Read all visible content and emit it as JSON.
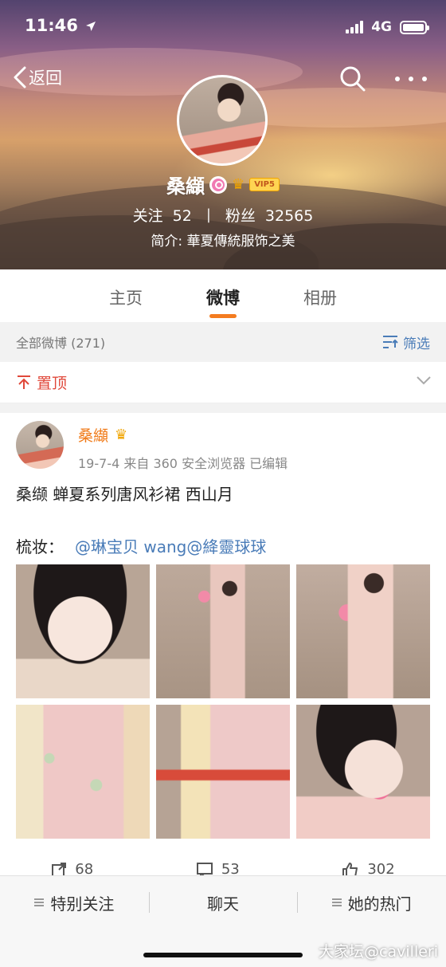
{
  "status_bar": {
    "time": "11:46",
    "network": "4G"
  },
  "nav": {
    "back_label": "返回"
  },
  "profile": {
    "name": "桑纈",
    "vip_label": "VIP5",
    "following_label": "关注",
    "following_count": "52",
    "followers_label": "粉丝",
    "followers_count": "32565",
    "bio": "简介: 華夏傳統服饰之美"
  },
  "tabs": [
    {
      "label": "主页",
      "active": false
    },
    {
      "label": "微博",
      "active": true
    },
    {
      "label": "相册",
      "active": false
    }
  ],
  "filter_bar": {
    "label": "全部微博 (271)",
    "filter_label": "筛选"
  },
  "pinned": {
    "label": "置顶"
  },
  "post": {
    "author": "桑纈",
    "meta": "19-7-4  来自 360 安全浏览器  已编辑",
    "text": "桑缬 蝉夏系列唐风衫裙 西山月",
    "makeup_label": "梳妆：",
    "mentions": "@琳宝贝 wang@絳靈球球",
    "actions": {
      "repost": "68",
      "comment": "53",
      "like": "302"
    }
  },
  "bottom_bar": [
    {
      "label": "特别关注"
    },
    {
      "label": "聊天"
    },
    {
      "label": "她的热门"
    }
  ],
  "watermark": "大家坛@cavilleri",
  "colors": {
    "accent": "#f47c20",
    "link": "#4a7cb8",
    "pin": "#e0483a",
    "author": "#f07a18"
  }
}
